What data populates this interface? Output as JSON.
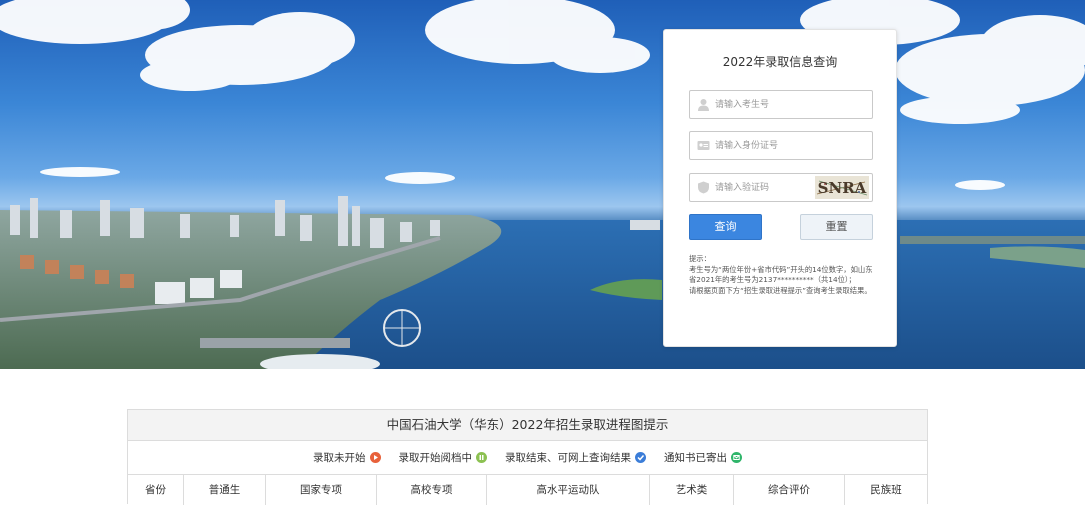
{
  "login": {
    "title": "2022年录取信息查询",
    "exam_placeholder": "请输入考生号",
    "id_placeholder": "请输入身份证号",
    "code_placeholder": "请输入验证码",
    "captcha_text": "SNRA",
    "query_label": "查询",
    "reset_label": "重置",
    "tips": [
      "提示：",
      "考生号为“两位年份+省市代码”开头的14位数字，如山东省2021年的考生号为2137**********（共14位）；",
      "请根据页面下方“招生录取进程提示”查询考生录取结果。"
    ]
  },
  "progress": {
    "title": "中国石油大学（华东）2022年招生录取进程图提示",
    "legend": [
      {
        "label": "录取未开始",
        "color": "#e8613a",
        "icon": "play-icon"
      },
      {
        "label": "录取开始阅档中",
        "color": "#8cc152",
        "icon": "pause-icon"
      },
      {
        "label": "录取结束、可网上查询结果",
        "color": "#3b7dd8",
        "icon": "check-icon"
      },
      {
        "label": "通知书已寄出",
        "color": "#2fb56a",
        "icon": "mail-icon"
      }
    ],
    "columns": [
      "省份",
      "普通生",
      "国家专项",
      "高校专项",
      "高水平运动队",
      "艺术类",
      "综合评价",
      "民族班"
    ]
  }
}
